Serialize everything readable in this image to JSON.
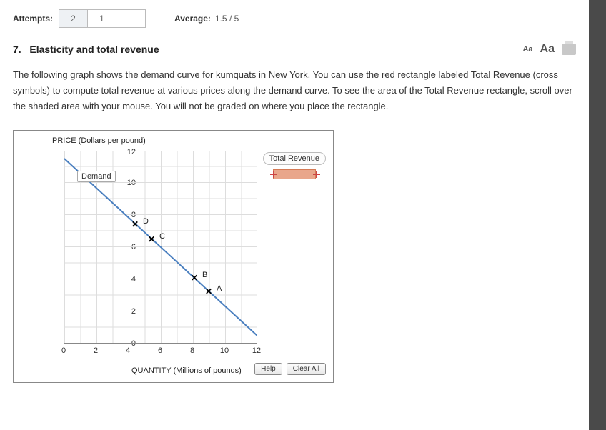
{
  "top": {
    "attempts_label": "Attempts:",
    "attempts": [
      "2",
      "1",
      ""
    ],
    "average_label": "Average:",
    "average_value": "1.5 / 5"
  },
  "question": {
    "number": "7.",
    "title": "Elasticity and total revenue",
    "text": "The following graph shows the demand curve for kumquats in New York. You can use the red rectangle labeled Total Revenue (cross symbols) to compute total revenue at various prices along the demand curve. To see the area of the Total Revenue rectangle, scroll over the shaded area with your mouse. You will not be graded on where you place the rectangle."
  },
  "tools": {
    "aa_small": "Aa",
    "aa_large": "Aa"
  },
  "graph": {
    "y_title": "PRICE (Dollars per pound)",
    "x_title": "QUANTITY (Millions of pounds)",
    "y_ticks": [
      "0",
      "2",
      "4",
      "6",
      "8",
      "10",
      "12"
    ],
    "x_ticks": [
      "0",
      "2",
      "4",
      "6",
      "8",
      "10",
      "12"
    ],
    "demand_label": "Demand",
    "legend_label": "Total Revenue",
    "points": {
      "A": "A",
      "B": "B",
      "C": "C",
      "D": "D"
    },
    "buttons": {
      "help": "Help",
      "clear": "Clear All"
    }
  },
  "chart_data": {
    "type": "line",
    "title": "Demand curve for kumquats",
    "xlabel": "QUANTITY (Millions of pounds)",
    "ylabel": "PRICE (Dollars per pound)",
    "xlim": [
      0,
      12
    ],
    "ylim": [
      0,
      12
    ],
    "series": [
      {
        "name": "Demand",
        "x": [
          0,
          12
        ],
        "y": [
          11.5,
          0.5
        ]
      }
    ],
    "markers": [
      {
        "label": "D",
        "x": 4.5,
        "y": 7.3
      },
      {
        "label": "C",
        "x": 5.5,
        "y": 6.4
      },
      {
        "label": "B",
        "x": 8.2,
        "y": 4.0
      },
      {
        "label": "A",
        "x": 9.1,
        "y": 3.2
      }
    ]
  }
}
